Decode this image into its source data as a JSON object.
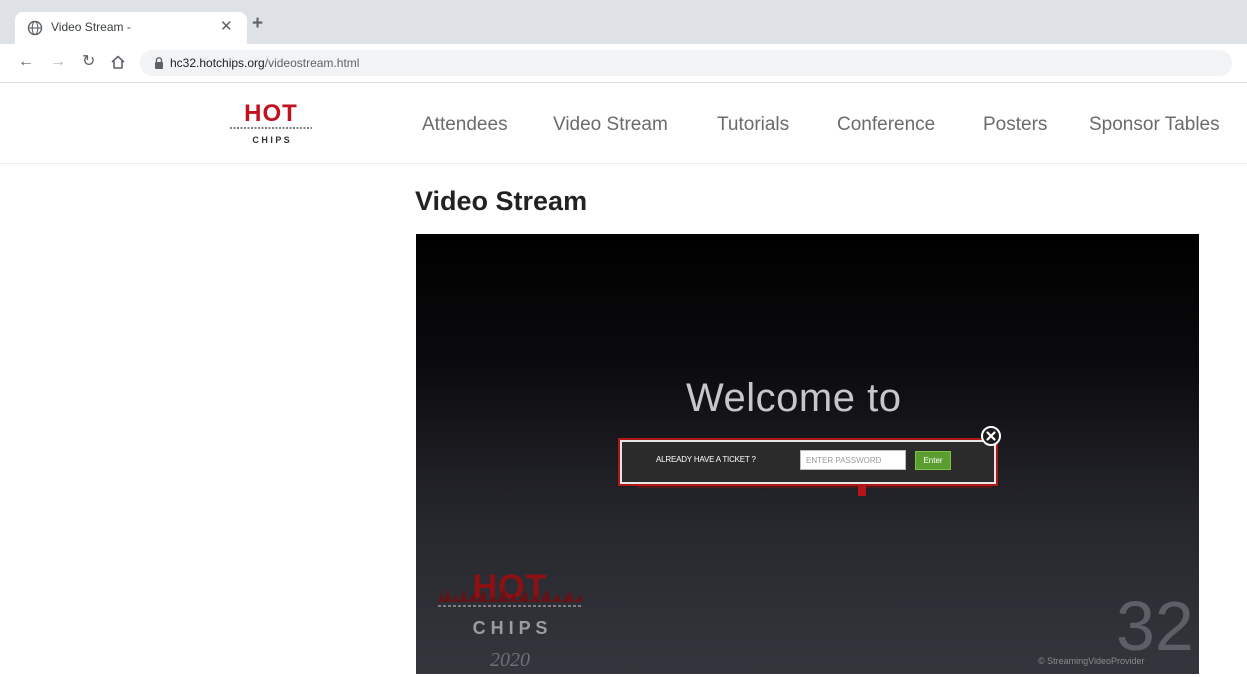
{
  "browser": {
    "tab": {
      "title": "Video Stream -"
    },
    "url_domain": "hc32.hotchips.org",
    "url_path": "/videostream.html",
    "icons": [
      "globe-icon",
      "close-icon",
      "plus-icon",
      "back-arrow-icon",
      "forward-arrow-icon",
      "reload-icon",
      "home-icon",
      "lock-icon"
    ]
  },
  "header": {
    "brand": {
      "top": "HOT",
      "bottom": "C H I P S"
    },
    "nav": [
      "Attendees",
      "Video Stream",
      "Tutorials",
      "Conference",
      "Posters",
      "Sponsor Tables"
    ]
  },
  "page": {
    "title": "Video Stream"
  },
  "player": {
    "welcome": "Welcome to",
    "ticket_label": "ALREADY HAVE A TICKET ?",
    "password_placeholder": "ENTER PASSWORD",
    "enter_label": "Enter",
    "logo": {
      "top": "HOT",
      "letters": "C H I P S",
      "year": "2020"
    },
    "number": "32",
    "credit": "© StreamingVideoProvider"
  },
  "colors": {
    "brand_red": "#c1121f",
    "enter_green": "#5a9e2f",
    "nav_text": "#6b6b6b"
  }
}
